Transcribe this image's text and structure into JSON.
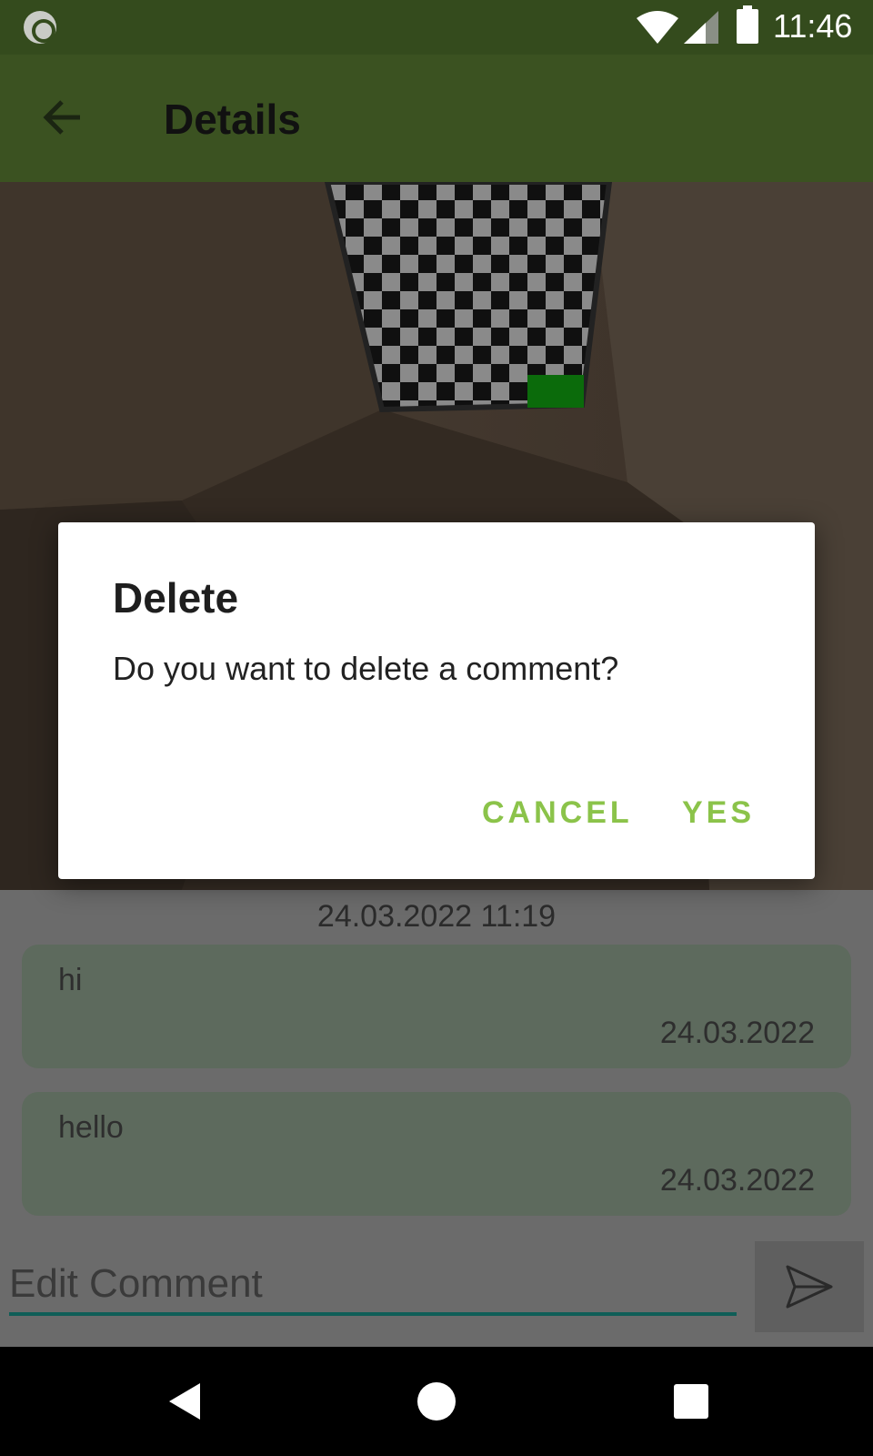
{
  "status_bar": {
    "time": "11:46",
    "icons": [
      "app-notification-icon",
      "wifi-icon",
      "cell-signal-icon",
      "battery-icon"
    ]
  },
  "app_bar": {
    "back_icon": "arrow-left-icon",
    "title": "Details"
  },
  "post": {
    "datetime": "24.03.2022 11:19"
  },
  "comments": [
    {
      "text": "hi",
      "date": "24.03.2022"
    },
    {
      "text": "hello",
      "date": "24.03.2022"
    }
  ],
  "comment_input": {
    "placeholder": "Edit Comment",
    "value": ""
  },
  "send_button": {
    "icon": "send-icon"
  },
  "dialog": {
    "title": "Delete",
    "message": "Do you want to delete a comment?",
    "cancel_label": "CANCEL",
    "confirm_label": "YES"
  },
  "nav_bar": {
    "icons": [
      "back-triangle-icon",
      "home-circle-icon",
      "recents-square-icon"
    ]
  },
  "colors": {
    "status_bar": "#344b1d",
    "app_bar": "#3b5221",
    "dialog_accent": "#8bc34a",
    "input_underline": "#0f5e57",
    "comment_bg": "#5d6a5d"
  }
}
